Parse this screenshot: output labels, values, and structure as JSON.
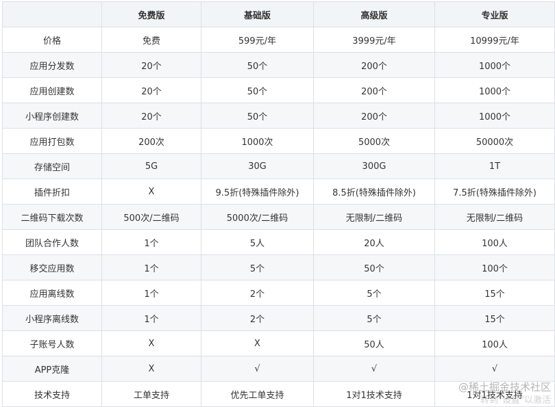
{
  "headers": [
    "",
    "免费版",
    "基础版",
    "高级版",
    "专业版"
  ],
  "rows": [
    [
      "价格",
      "免费",
      "599元/年",
      "3999元/年",
      "10999元/年"
    ],
    [
      "应用分发数",
      "20个",
      "50个",
      "200个",
      "1000个"
    ],
    [
      "应用创建数",
      "20个",
      "50个",
      "200个",
      "1000个"
    ],
    [
      "小程序创建数",
      "20个",
      "50个",
      "200个",
      "1000个"
    ],
    [
      "应用打包数",
      "200次",
      "1000次",
      "5000次",
      "50000次"
    ],
    [
      "存储空间",
      "5G",
      "30G",
      "300G",
      "1T"
    ],
    [
      "插件折扣",
      "X",
      "9.5折(特殊插件除外)",
      "8.5折(特殊插件除外)",
      "7.5折(特殊插件除外)"
    ],
    [
      "二维码下载次数",
      "500次/二维码",
      "5000次/二维码",
      "无限制/二维码",
      "无限制/二维码"
    ],
    [
      "团队合作人数",
      "1个",
      "5人",
      "20人",
      "100人"
    ],
    [
      "移交应用数",
      "1个",
      "5个",
      "50个",
      "100个"
    ],
    [
      "应用离线数",
      "1个",
      "2个",
      "5个",
      "15个"
    ],
    [
      "小程序离线数",
      "1个",
      "2个",
      "5个",
      "15个"
    ],
    [
      "子账号人数",
      "X",
      "X",
      "50人",
      "100人"
    ],
    [
      "APP克隆",
      "X",
      "√",
      "√",
      "√"
    ],
    [
      "技术支持",
      "工单支持",
      "优先工单支持",
      "1对1技术支持",
      "1对1技术支持"
    ]
  ],
  "watermark": "@稀土掘金技术社区",
  "watermark_secondary": "转到\"设置\"以激活"
}
